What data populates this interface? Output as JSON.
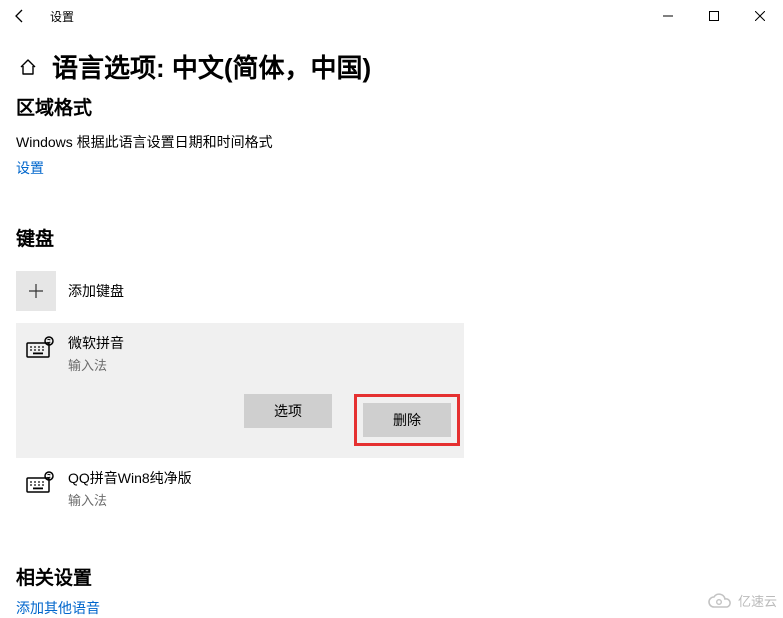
{
  "titlebar": {
    "app_title": "设置"
  },
  "page": {
    "title": "语言选项: 中文(简体，中国)"
  },
  "region": {
    "heading": "区域格式",
    "desc": "Windows 根据此语言设置日期和时间格式",
    "settings_link": "设置"
  },
  "keyboard": {
    "heading": "键盘",
    "add_label": "添加键盘",
    "items": [
      {
        "name": "微软拼音",
        "sub": "输入法"
      },
      {
        "name": "QQ拼音Win8纯净版",
        "sub": "输入法"
      }
    ],
    "options_label": "选项",
    "remove_label": "删除"
  },
  "related": {
    "heading": "相关设置",
    "add_voice_link": "添加其他语音"
  },
  "watermark": {
    "text": "亿速云"
  },
  "icons": {
    "back": "back-icon",
    "minimize": "minimize-icon",
    "maximize": "maximize-icon",
    "close": "close-icon",
    "home": "home-icon",
    "plus": "plus-icon",
    "keyboard": "keyboard-icon",
    "cloud": "cloud-icon"
  }
}
